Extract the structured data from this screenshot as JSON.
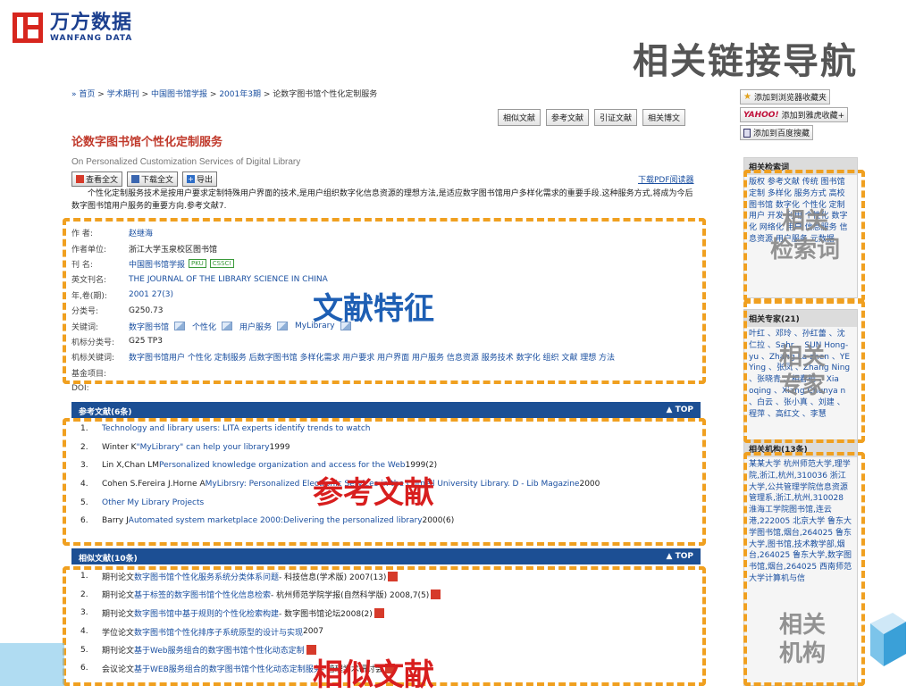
{
  "slide": {
    "logo_cn": "万方数据",
    "logo_en": "WANFANG DATA",
    "title": "相关链接导航"
  },
  "breadcrumb": {
    "home": "首页",
    "items": [
      "学术期刊",
      "中国图书馆学报",
      "2001年3期"
    ],
    "current": "论数字图书馆个性化定制服务",
    "sep": ">"
  },
  "top_tabs": [
    "相似文献",
    "参考文献",
    "引证文献",
    "相关博文"
  ],
  "article": {
    "title": "论数字图书馆个性化定制服务",
    "title_en": "On Personalized Customization Services of Digital Library",
    "actions": [
      "查看全文",
      "下载全文",
      "导出"
    ],
    "pdf_reader": "下载PDF阅读器",
    "abstract": "个性化定制服务技术是按用户要求定制特殊用户界面的技术,是用户组织数字化信息资源的理想方法,是适应数字图书馆用户多样化需求的重要手段.这种服务方式,将成为今后数字图书馆用户服务的重要方向.参考文献7."
  },
  "meta": {
    "author_k": "作 者:",
    "author_v": "赵继海",
    "unit_k": "作者单位:",
    "unit_v": "浙江大学玉泉校区图书馆",
    "journal_k": "刊 名:",
    "journal_v": "中国图书馆学报",
    "badge1": "PKU",
    "badge2": "CSSCI",
    "en_k": "英文刊名:",
    "en_v": "THE JOURNAL OF THE LIBRARY SCIENCE IN CHINA",
    "year_k": "年,卷(期):",
    "year_v": "2001 27(3)",
    "class_k": "分类号:",
    "class_v": "G250.73",
    "kw_k": "关键词:",
    "kw": [
      "数字图书馆",
      "个性化",
      "用户服务",
      "MyLibrary"
    ],
    "mclass_k": "机标分类号:",
    "mclass_v": "G25 TP3",
    "mkw_k": "机标关键词:",
    "mkw_v": "数字图书馆用户 个性化 定制服务 后数字图书馆 多样化需求 用户要求 用户界面 用户服务 信息资源 服务技术 数字化 组织 文献 理想 方法",
    "fund_k": "基金项目:",
    "doi_k": "DOI:"
  },
  "refs": {
    "header": "参考文献(6条)",
    "top": "TOP",
    "items": [
      {
        "num": "1.",
        "pre": "",
        "link": "Technology and library users: LITA experts identify trends to watch",
        "post": ""
      },
      {
        "num": "2.",
        "pre": "Winter K ",
        "link": "\"MyLibrary\" can help your library",
        "post": " 1999"
      },
      {
        "num": "3.",
        "pre": "Lin X,Chan LM ",
        "link": "Personalized knowledge organization and access for the Web",
        "post": " 1999(2)"
      },
      {
        "num": "4.",
        "pre": "Cohen S.Fereira J.Horne A ",
        "link": "MyLibrsry: Personalized Electronic Services in the Cornell University Library. D - Lib Magazine",
        "post": " 2000"
      },
      {
        "num": "5.",
        "pre": "",
        "link": "Other My Library Projects",
        "post": ""
      },
      {
        "num": "6.",
        "pre": "Barry J ",
        "link": "Automated system marketplace 2000:Delivering the personalized library",
        "post": " 2000(6)"
      }
    ]
  },
  "similar": {
    "header": "相似文献(10条)",
    "top": "TOP",
    "items": [
      {
        "num": "1.",
        "pre": "期刊论文 ",
        "link": "数字图书馆个性化服务系统分类体系问题",
        "post": " - 科技信息(学术版) 2007(13)",
        "pdf": true
      },
      {
        "num": "2.",
        "pre": "期刊论文 ",
        "link": "基于标签的数字图书馆个性化信息检索",
        "post": " - 杭州师范学院学报(自然科学版) 2008,7(5)",
        "pdf": true
      },
      {
        "num": "3.",
        "pre": "期刊论文 ",
        "link": "数字图书馆中基于规则的个性化检索构建",
        "post": " - 数字图书馆论坛2008(2)",
        "pdf": true
      },
      {
        "num": "4.",
        "pre": "学位论文 ",
        "link": "数字图书馆个性化排序子系统原型的设计与实现",
        "post": " 2007",
        "pdf": false
      },
      {
        "num": "5.",
        "pre": "期刊论文 ",
        "link": "基于Web服务组合的数字图书馆个性化动态定制",
        "post": "",
        "pdf": true
      },
      {
        "num": "6.",
        "pre": "会议论文 ",
        "link": "基于WEB服务组合的数字图书馆个性化动态定制服务",
        "post": " - 管理学术研讨会",
        "pdf": true
      }
    ]
  },
  "sidebar": {
    "fav1": "添加到浏览器收藏夹",
    "yahoo": "YAHOO!",
    "fav2": "添加到雅虎收藏+",
    "fav3": "添加到百度搜藏",
    "search_head": "相关检索词",
    "search_terms": "版权 参考文献 传统 图书馆 定制 多样化 服务方式 高校图书馆 数字化 个性化 定制 用户 开发 利用 个性化 数字化 网络化 用户 信息服务 信息资源 用户服务 元数据",
    "expert_head": "相关专家(21)",
    "experts": "叶红 、邓玲 、孙红蕾 、沈仁拉 、Sahr 、SUN Hong-yu 、Zhang La-zhen 、YE Ying 、张凤 、Zhang Ning 、张晓青 、相春艳 、Xia oqing 、Xiang Chunya n 、白云 、张小真 、刘建 、程萍 、高红文 、李慧",
    "org_head": "相关机构(13条)",
    "orgs": "某某大学 杭州师范大学,理学院,浙江,杭州,310036 浙江大学,公共管理学院信息资源管理系,浙江,杭州,310028 淮海工学院图书馆,连云港,222005 北京大学 鲁东大学图书馆,烟台,264025 鲁东大学,图书馆,技术教学部,烟台,264025 鲁东大学,数字图书馆,烟台,264025 西南师范大学计算机与信"
  },
  "overlays": {
    "features": "文献特征",
    "refs": "参考文献",
    "similar": "相似文献",
    "search": "相关\n检索词",
    "experts": "相关\n专家",
    "orgs": "相关\n机构"
  },
  "colors": {
    "brand_red": "#d7261e",
    "brand_blue": "#1b3f8f",
    "link": "#1a4fa0",
    "section_bar": "#1c4f94",
    "dashed": "#f0a020",
    "overlay_blue": "#1e5fb4",
    "overlay_red": "#d81e1e"
  }
}
